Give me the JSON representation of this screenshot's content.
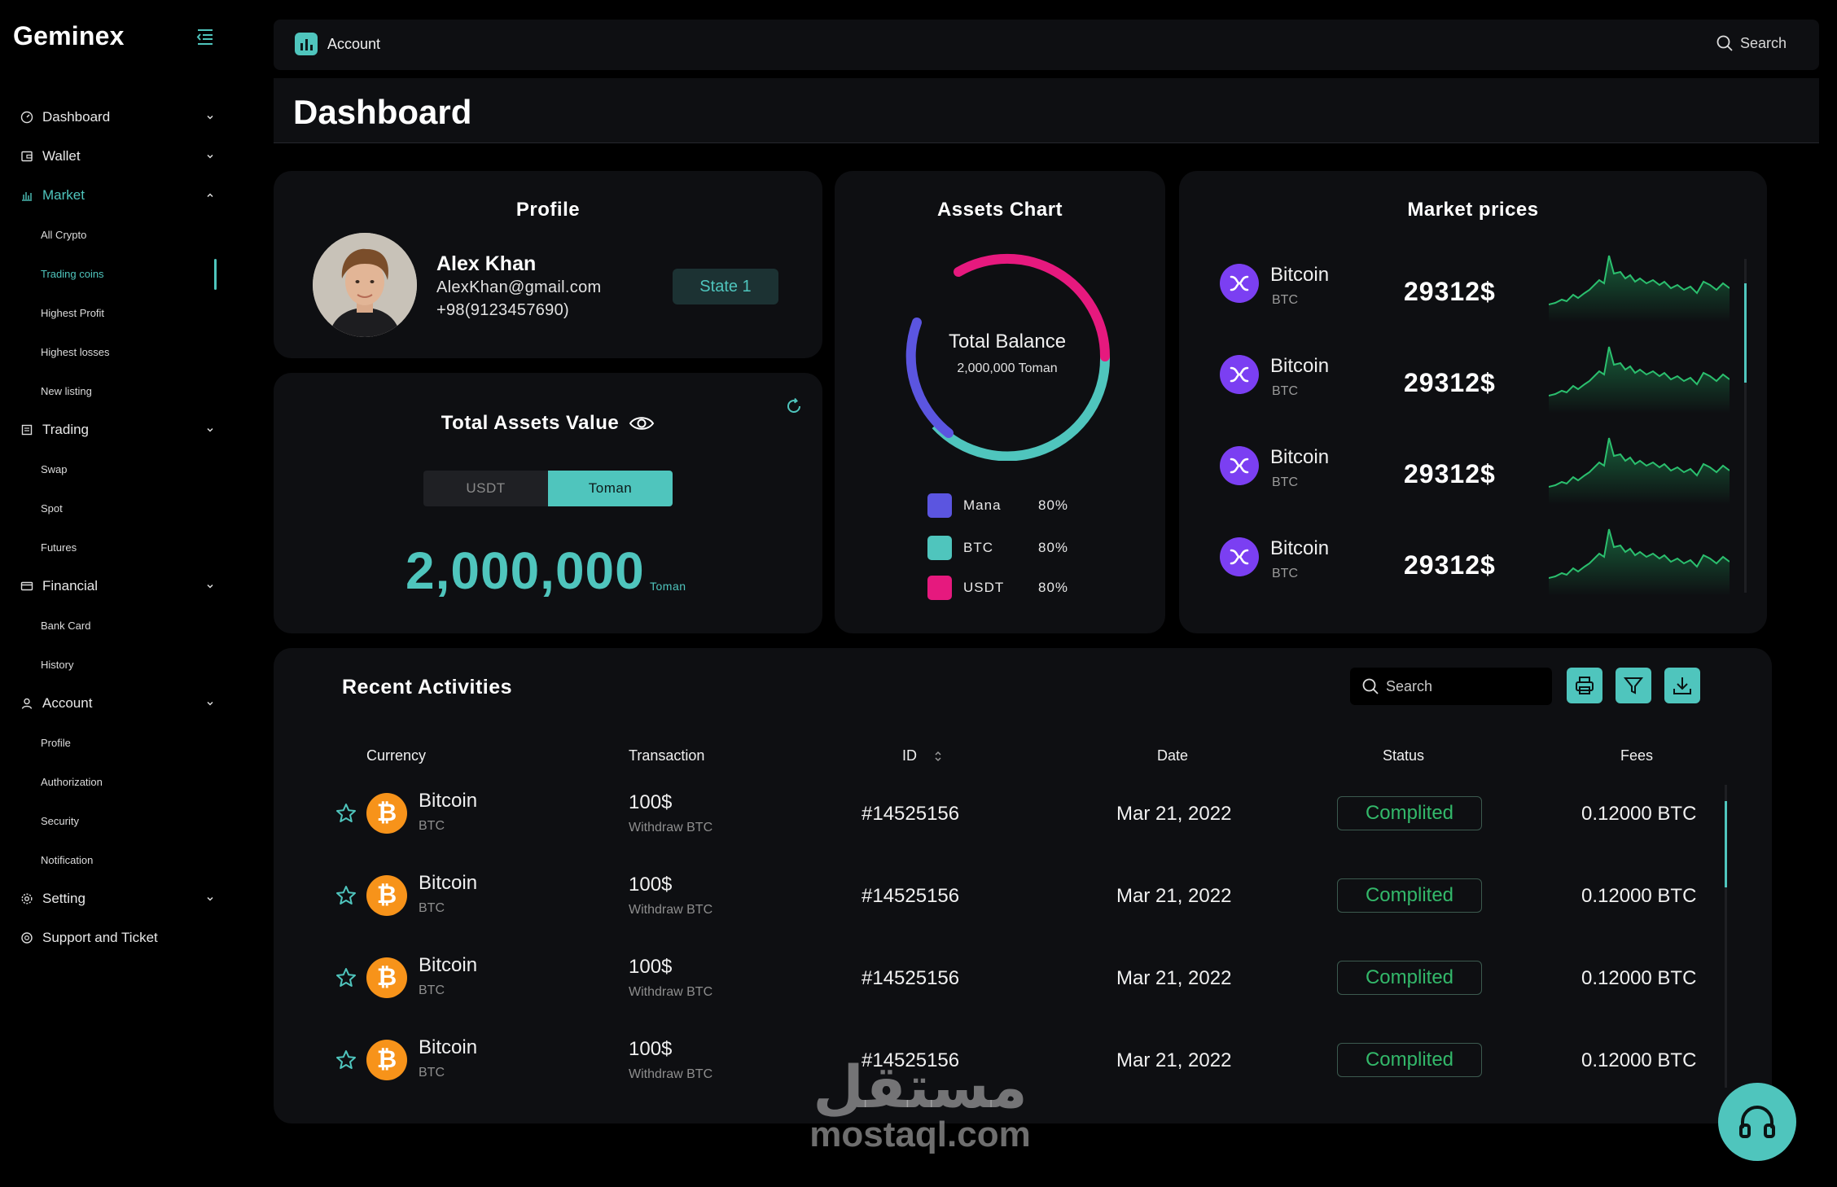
{
  "brand": "Geminex",
  "sidebar": {
    "items": [
      {
        "label": "Dashboard"
      },
      {
        "label": "Wallet"
      },
      {
        "label": "Market"
      },
      {
        "label": "Trading"
      },
      {
        "label": "Financial"
      },
      {
        "label": "Account"
      },
      {
        "label": "Setting"
      },
      {
        "label": "Support and Ticket"
      }
    ],
    "market_sub": [
      "All Crypto",
      "Trading coins",
      "Highest Profit",
      "Highest losses",
      "New listing"
    ],
    "trading_sub": [
      "Swap",
      "Spot",
      "Futures"
    ],
    "financial_sub": [
      "Bank Card",
      "History"
    ],
    "account_sub": [
      "Profile",
      "Authorization",
      "Security",
      "Notification"
    ]
  },
  "topbar": {
    "account_label": "Account",
    "search_label": "Search"
  },
  "page_title": "Dashboard",
  "profile": {
    "title": "Profile",
    "name": "Alex Khan",
    "email": "AlexKhan@gmail.com",
    "phone": "+98(9123457690)",
    "state": "State 1"
  },
  "assets": {
    "title": "Total Assets Value",
    "tab_usdt": "USDT",
    "tab_toman": "Toman",
    "value": "2,000,000",
    "unit": "Toman"
  },
  "assets_chart": {
    "title": "Assets Chart",
    "center_title": "Total Balance",
    "center_value": "2,000,000 Toman",
    "legend": [
      {
        "name": "Mana",
        "pct": "80%",
        "color": "#5b55e0"
      },
      {
        "name": "BTC",
        "pct": "80%",
        "color": "#4fc5bd"
      },
      {
        "name": "USDT",
        "pct": "80%",
        "color": "#e6197e"
      }
    ]
  },
  "market": {
    "title": "Market prices",
    "rows": [
      {
        "name": "Bitcoin",
        "symbol": "BTC",
        "price": "29312$"
      },
      {
        "name": "Bitcoin",
        "symbol": "BTC",
        "price": "29312$"
      },
      {
        "name": "Bitcoin",
        "symbol": "BTC",
        "price": "29312$"
      },
      {
        "name": "Bitcoin",
        "symbol": "BTC",
        "price": "29312$"
      }
    ]
  },
  "recent": {
    "title": "Recent Activities",
    "search_placeholder": "Search",
    "columns": [
      "Currency",
      "Transaction",
      "ID",
      "Date",
      "Status",
      "Fees"
    ],
    "rows": [
      {
        "coin": "Bitcoin",
        "symbol": "BTC",
        "amount": "100$",
        "desc": "Withdraw BTC",
        "id": "#14525156",
        "date": "Mar 21, 2022",
        "status": "Complited",
        "fee": "0.12000 BTC"
      },
      {
        "coin": "Bitcoin",
        "symbol": "BTC",
        "amount": "100$",
        "desc": "Withdraw BTC",
        "id": "#14525156",
        "date": "Mar 21, 2022",
        "status": "Complited",
        "fee": "0.12000 BTC"
      },
      {
        "coin": "Bitcoin",
        "symbol": "BTC",
        "amount": "100$",
        "desc": "Withdraw BTC",
        "id": "#14525156",
        "date": "Mar 21, 2022",
        "status": "Complited",
        "fee": "0.12000 BTC"
      },
      {
        "coin": "Bitcoin",
        "symbol": "BTC",
        "amount": "100$",
        "desc": "Withdraw BTC",
        "id": "#14525156",
        "date": "Mar 21, 2022",
        "status": "Complited",
        "fee": "0.12000 BTC"
      }
    ]
  },
  "watermark": {
    "arabic": "مستقل",
    "latin": "mostaql.com"
  },
  "colors": {
    "accent": "#4fc5bd",
    "card": "#0e0f12",
    "success": "#33b86a",
    "violet": "#7b3ff2",
    "magenta": "#e6197e",
    "indigo": "#5b55e0"
  }
}
